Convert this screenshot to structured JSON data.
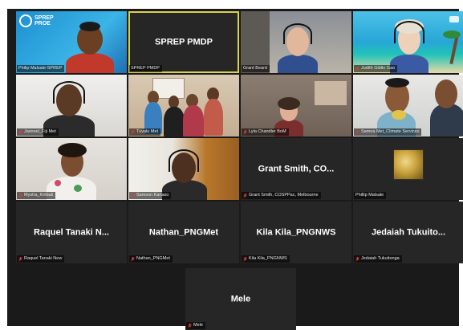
{
  "meeting": {
    "tiles": [
      {
        "label": "Philip Malsale-SPREP",
        "display_name": "",
        "logo_text": "SPREP PROE",
        "muted": false,
        "kind": "video",
        "active": false
      },
      {
        "label": "SPREP PMDP",
        "display_name": "SPREP PMDP",
        "muted": false,
        "kind": "name",
        "active": true
      },
      {
        "label": "Grant Beard",
        "display_name": "",
        "muted": false,
        "kind": "video",
        "active": false
      },
      {
        "label": "Judith Giblin Gao",
        "display_name": "",
        "muted": true,
        "kind": "video",
        "active": false
      },
      {
        "label": "Jasneel_Fiji Met",
        "display_name": "",
        "muted": true,
        "kind": "video",
        "active": false
      },
      {
        "label": "Tuvalu Met",
        "display_name": "",
        "muted": true,
        "kind": "video",
        "active": false
      },
      {
        "label": "Lyla Chandler BoM",
        "display_name": "",
        "muted": true,
        "kind": "video",
        "active": false
      },
      {
        "label": "Samoa Met_Climate Services",
        "display_name": "",
        "muted": true,
        "kind": "video",
        "active": false
      },
      {
        "label": "Mystra_Kiribati",
        "display_name": "",
        "muted": true,
        "kind": "video",
        "active": false
      },
      {
        "label": "Samson Kanaso",
        "display_name": "",
        "muted": true,
        "kind": "video",
        "active": false
      },
      {
        "label": "Grant Smith, COSPPac, Melbourne",
        "display_name": "Grant Smith, CO...",
        "muted": true,
        "kind": "name",
        "active": false
      },
      {
        "label": "Phillip Malsale",
        "display_name": "",
        "muted": false,
        "kind": "photo",
        "active": false
      },
      {
        "label": "Raquel Tanaki New",
        "display_name": "Raquel Tanaki N...",
        "muted": true,
        "kind": "name",
        "active": false
      },
      {
        "label": "Nathan_PNGMet",
        "display_name": "Nathan_PNGMet",
        "muted": true,
        "kind": "name",
        "active": false
      },
      {
        "label": "Kila Kila_PNGNWS",
        "display_name": "Kila Kila_PNGNWS",
        "muted": true,
        "kind": "name",
        "active": false
      },
      {
        "label": "Jedaiah Tukuitonga",
        "display_name": "Jedaiah Tukuito...",
        "muted": true,
        "kind": "name",
        "active": false
      }
    ],
    "last_tile": {
      "label": "Mele",
      "display_name": "Mele",
      "muted": true,
      "kind": "name"
    }
  },
  "colors": {
    "background": "#1a1a1a",
    "tile": "#262626",
    "active_outline": "#d9d24a",
    "mute_red": "#e03c31"
  },
  "icons": {
    "mute": "mic-muted-icon",
    "logo": "sprep-logo-icon"
  }
}
